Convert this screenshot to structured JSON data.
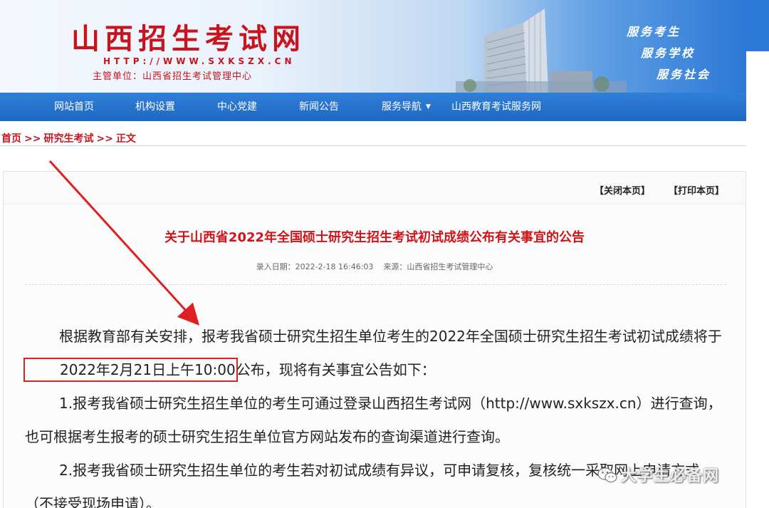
{
  "header": {
    "site_title": "山西招生考试网",
    "url": "HTTP://WWW.SXKSZX.CN",
    "supervisor": "主管单位：山西省招生考试管理中心",
    "slogans": [
      "服务考生",
      "服务学校",
      "服务社会"
    ]
  },
  "nav": {
    "items": [
      {
        "label": "网站首页"
      },
      {
        "label": "机构设置"
      },
      {
        "label": "中心党建"
      },
      {
        "label": "新闻公告"
      },
      {
        "label": "服务导航",
        "dropdown": true
      },
      {
        "label": "山西教育考试服务网"
      }
    ]
  },
  "breadcrumb": {
    "items": [
      "首页",
      "研究生考试",
      "正文"
    ],
    "separator": ">>"
  },
  "toolbar": {
    "close_label": "【关闭本页】",
    "print_label": "【打印本页】"
  },
  "article": {
    "title": "关于山西省2022年全国硕士研究生招生考试初试成绩公布有关事宜的公告",
    "date_label": "录入日期：",
    "date": "2022-2-18 16:46:03",
    "source_label": "来源：",
    "source": "山西省招生考试管理中心",
    "para1_before": "根据教育部有关安排，报考我省硕士研究生招生单位考生的2022年全国硕士研究生招生考试初试成绩将于",
    "para1_highlight": "2022年2月21日上午10:00",
    "para1_after": "公布，现将有关事宜公告如下：",
    "para2": "1.报考我省硕士研究生招生单位的考生可通过登录山西招生考试网（http://www.sxkszx.cn）进行查询，也可根据考生报考的硕士研究生招生单位官方网站发布的查询渠道进行查询。",
    "para3": "2.报考我省硕士研究生招生单位的考生若对初试成绩有异议，可申请复核，复核统一采取网上申请方式（不接受现场申请）。"
  },
  "watermark": {
    "text": "大学生必备网",
    "icon": "wechat-icon"
  },
  "colors": {
    "brand_red": "#c8141e",
    "nav_blue": "#1f68c4",
    "title_red": "#d2141a",
    "annotation_red": "#e02020"
  }
}
